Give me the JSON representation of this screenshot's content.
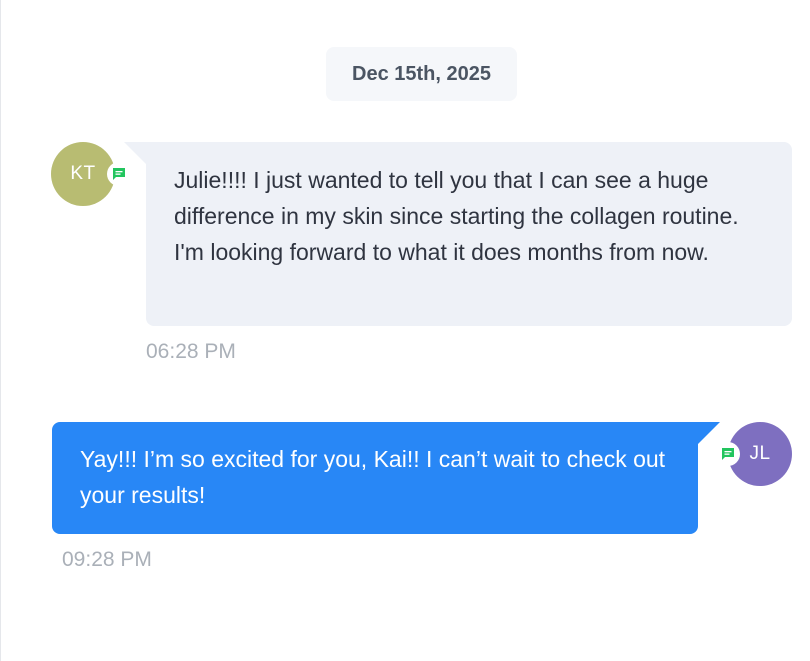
{
  "conversation": {
    "date_label": "Dec 15th, 2025",
    "messages": [
      {
        "direction": "incoming",
        "avatar_initials": "KT",
        "avatar_color": "#b8bc72",
        "channel_icon": "chat-bubble-icon",
        "channel_color": "#22c55e",
        "text": "Julie!!!! I just wanted to tell you that I can see a huge difference in my skin since starting the collagen routine. I'm looking forward to what it does months from now.",
        "time": "06:28 PM",
        "bubble_color": "#eef1f7"
      },
      {
        "direction": "outgoing",
        "avatar_initials": "JL",
        "avatar_color": "#7e6fc0",
        "channel_icon": "chat-bubble-icon",
        "channel_color": "#22c55e",
        "text": "Yay!!! I’m so excited for you, Kai!! I can’t wait to check out your results!",
        "time": "09:28 PM",
        "bubble_color": "#2887f6"
      }
    ]
  }
}
